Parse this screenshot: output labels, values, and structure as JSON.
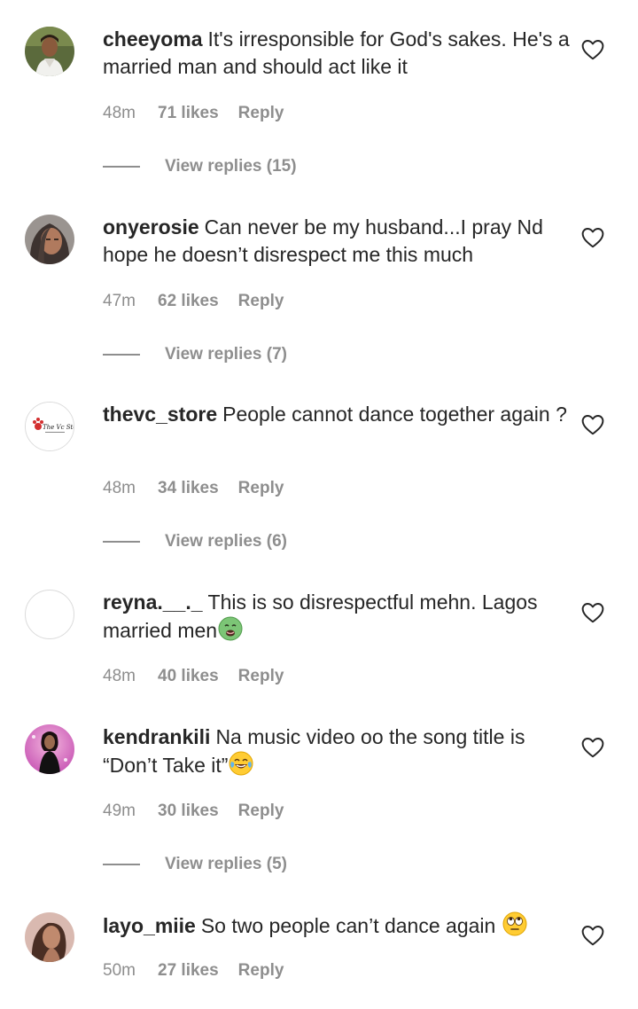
{
  "comments": [
    {
      "username": "cheeyoma",
      "text": "It's irresponsible for God's sakes. He's a married man and should act like it",
      "time": "48m",
      "likes": "71 likes",
      "reply": "Reply",
      "view_replies": "View replies (15)"
    },
    {
      "username": "onyerosie",
      "text": "Can never be my husband...I pray Nd hope he doesn’t disrespect me this much",
      "time": "47m",
      "likes": "62 likes",
      "reply": "Reply",
      "view_replies": "View replies (7)"
    },
    {
      "username": "thevc_store",
      "text": "People cannot dance together again ?",
      "time": "48m",
      "likes": "34 likes",
      "reply": "Reply",
      "view_replies": "View replies (6)",
      "avatar_logo_text": "The Vc Store"
    },
    {
      "username": "reyna.__._",
      "text": "This is so disrespectful mehn. Lagos married men",
      "emoji": "nauseated-face-emoji",
      "time": "48m",
      "likes": "40 likes",
      "reply": "Reply"
    },
    {
      "username": "kendrankili",
      "text": "Na music video oo the song title is “Don’t Take it”",
      "emoji": "tears-of-joy-emoji",
      "time": "49m",
      "likes": "30 likes",
      "reply": "Reply",
      "view_replies": "View replies (5)"
    },
    {
      "username": "layo_miie",
      "text": "So two people can’t dance again",
      "emoji": "eye-roll-emoji",
      "time": "50m",
      "likes": "27 likes",
      "reply": "Reply"
    }
  ],
  "colors": {
    "text": "#262626",
    "secondary": "#8e8e8e",
    "background": "#ffffff"
  },
  "icons": {
    "like": "heart-outline-icon"
  }
}
